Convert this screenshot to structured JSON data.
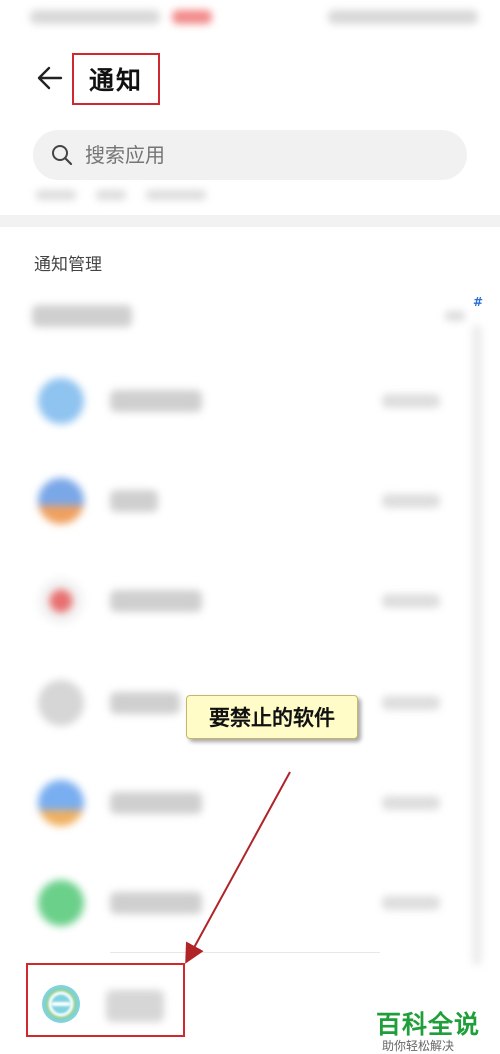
{
  "header": {
    "title": "通知",
    "back_icon": "arrow-left-icon"
  },
  "search": {
    "placeholder": "搜索应用",
    "icon": "search-icon"
  },
  "section": {
    "title": "通知管理"
  },
  "index_bar": {
    "top_label": "#"
  },
  "apps": [
    {
      "icon_color": "#8fc3f0"
    },
    {
      "icon_color": "#7aa7e8"
    },
    {
      "icon_color": "#e87070"
    },
    {
      "icon_color": "#d0d0d0"
    },
    {
      "icon_color": "#79aef0"
    },
    {
      "icon_color": "#6bd08a"
    }
  ],
  "annotation": {
    "callout_text": "要禁止的软件",
    "highlight_color": "#d0282e"
  },
  "watermark": {
    "brand": "百科全说",
    "slogan": "助你轻松解决"
  }
}
